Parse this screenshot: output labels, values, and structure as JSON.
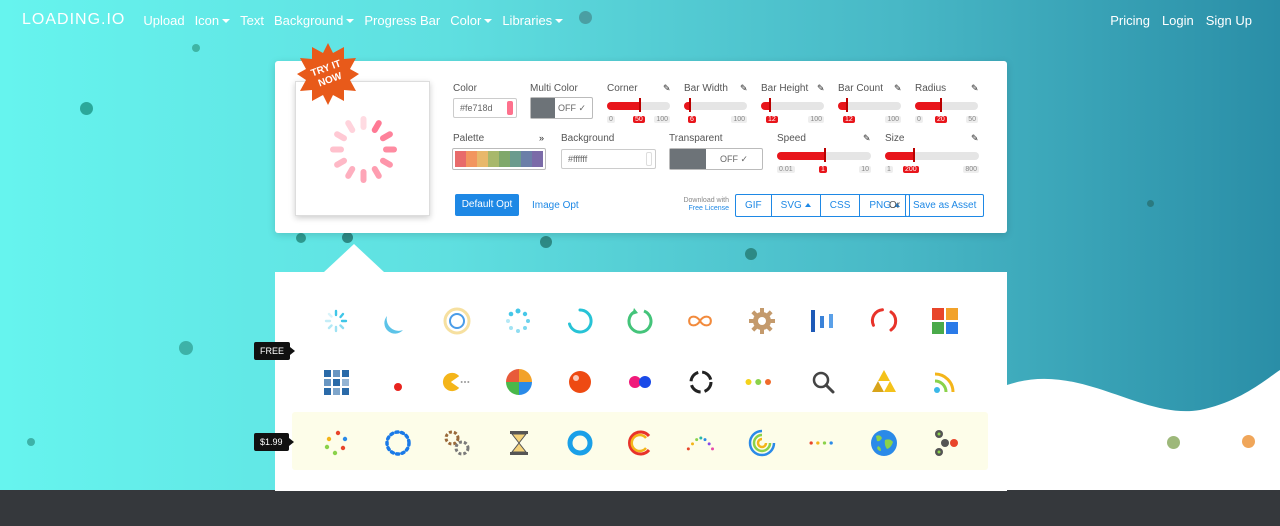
{
  "nav": {
    "logo": "LOADING.IO",
    "items": [
      {
        "label": "Upload",
        "dropdown": false
      },
      {
        "label": "Icon",
        "dropdown": true
      },
      {
        "label": "Text",
        "dropdown": false
      },
      {
        "label": "Background",
        "dropdown": true
      },
      {
        "label": "Progress Bar",
        "dropdown": false
      },
      {
        "label": "Color",
        "dropdown": true
      },
      {
        "label": "Libraries",
        "dropdown": true
      }
    ],
    "right": [
      "Pricing",
      "Login",
      "Sign Up"
    ]
  },
  "badge": {
    "line1": "TRY IT",
    "line2": "NOW"
  },
  "editor": {
    "color": {
      "label": "Color",
      "value": "#fe718d"
    },
    "multi_color": {
      "label": "Multi Color",
      "state": "OFF ✓"
    },
    "corner": {
      "label": "Corner",
      "min": "0",
      "max": "100",
      "value": "50"
    },
    "bar_width": {
      "label": "Bar Width",
      "min": "0",
      "max": "100",
      "value": "6"
    },
    "bar_height": {
      "label": "Bar Height",
      "min": "0",
      "max": "100",
      "value": "12"
    },
    "bar_count": {
      "label": "Bar Count",
      "min": "0",
      "max": "100",
      "value": "12"
    },
    "radius": {
      "label": "Radius",
      "min": "0",
      "max": "50",
      "value": "20"
    },
    "palette": {
      "label": "Palette",
      "colors": [
        "#e86b6b",
        "#f2955f",
        "#e8b86b",
        "#a8b86b",
        "#7fa86b",
        "#6b9b8e",
        "#6b7fa8",
        "#7b6ba8"
      ]
    },
    "background": {
      "label": "Background",
      "value": "#ffffff"
    },
    "transparent": {
      "label": "Transparent",
      "state": "OFF ✓"
    },
    "speed": {
      "label": "Speed",
      "min": "0.01",
      "max": "10",
      "value": "1"
    },
    "size": {
      "label": "Size",
      "min": "1",
      "max": "800",
      "value": "200"
    },
    "default_opt": "Default Opt",
    "image_opt": "Image Opt",
    "download_with": "Download with",
    "free_license": "Free License",
    "formats": [
      "GIF",
      "SVG",
      "CSS",
      "PNG"
    ],
    "or": "Or",
    "save_asset": "Save as Asset",
    "accent": "#e8151b",
    "spinner_color": "#fe718d"
  },
  "gallery": {
    "free_tag": "FREE",
    "premium_tag": "$1.99"
  }
}
